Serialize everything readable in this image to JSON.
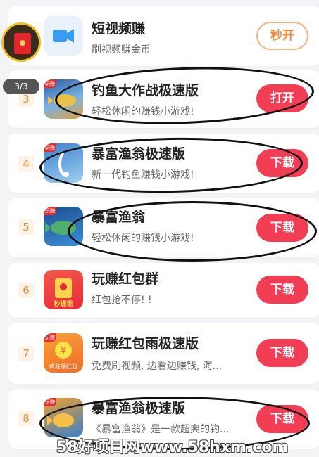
{
  "floating": {
    "counter": "3/3"
  },
  "apps": [
    {
      "rank": "",
      "title": "短视频赚",
      "desc": "刷视频赚金币",
      "button": "秒开"
    },
    {
      "rank": "3",
      "title": "钓鱼大作战极速版",
      "desc": "轻松休闲的赚钱小游戏!",
      "button": "打开",
      "tag": "玩赚"
    },
    {
      "rank": "4",
      "title": "暴富渔翁极速版",
      "desc": "新一代钓鱼赚钱小游戏!",
      "button": "下载",
      "tag": "玩赚"
    },
    {
      "rank": "5",
      "title": "暴富渔翁",
      "desc": "轻松休闲的赚钱小游戏!",
      "button": "下载",
      "tag": "玩赚"
    },
    {
      "rank": "6",
      "title": "玩赚红包群",
      "desc": "红包抢不停! !",
      "button": "下载",
      "icon_text": "秒提现"
    },
    {
      "rank": "7",
      "title": "玩赚红包雨极速版",
      "desc": "免费刷视频, 边看边赚钱, 海...",
      "button": "下载",
      "tag": "玩赚",
      "icon_text": "疯狂领红包"
    },
    {
      "rank": "8",
      "title": "暴富渔翁极速版",
      "desc": "《暴富渔翁》是一款超爽的钓...",
      "button": "下载",
      "tag": "玩赚"
    }
  ],
  "watermark": "58好项目网www.58hxm.com",
  "colors": {
    "accent": "#f23e55",
    "rank": "#f08a3a",
    "background": "#f4f4f6"
  }
}
